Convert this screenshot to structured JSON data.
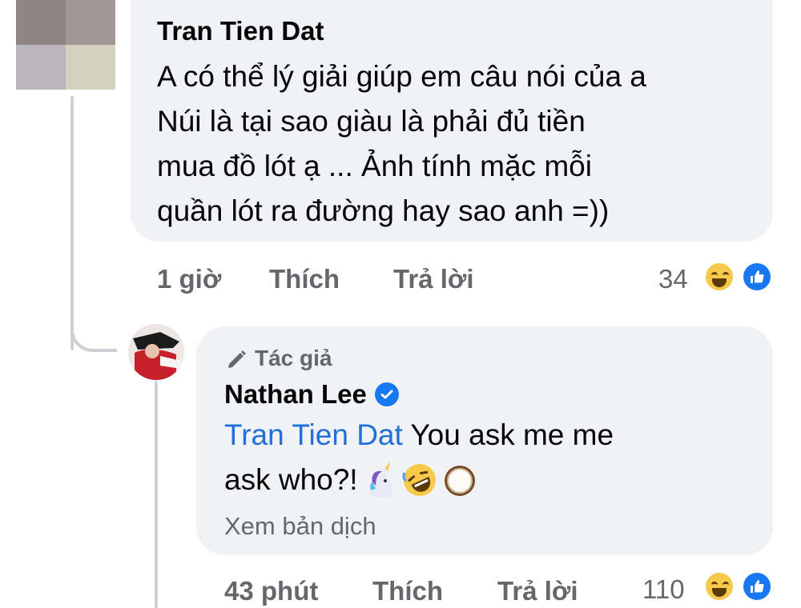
{
  "colors": {
    "bubble_bg": "#f0f2f5",
    "meta_text": "#65676b",
    "mention": "#216fdb",
    "reaction_like": "#1877f2",
    "reaction_haha": "#f7c94b"
  },
  "comment1": {
    "author": "Tran Tien Dat",
    "lines": [
      "A có thể lý giải giúp em câu nói của a",
      "Núi là tại sao giàu là phải đủ tiền",
      "mua đồ lót ạ ... Ảnh tính mặc mỗi",
      "quần lót ra đường hay sao anh =))"
    ],
    "time": "1 giờ",
    "like_label": "Thích",
    "reply_label": "Trả lời",
    "reaction_count": "34",
    "reactions": [
      "haha-icon",
      "like-icon"
    ]
  },
  "reply": {
    "author_tag": "Tác giả",
    "author": "Nathan Lee",
    "verified": true,
    "mention": "Tran Tien Dat",
    "text_line1": " You ask me me",
    "text_line2": "ask who?!",
    "emojis": [
      "unicorn-emoji",
      "rofl-emoji",
      "coconut-emoji"
    ],
    "translate_label": "Xem bản dịch",
    "time": "43 phút",
    "like_label": "Thích",
    "reply_label": "Trả lời",
    "reaction_count": "110",
    "reactions": [
      "haha-icon",
      "like-icon"
    ]
  }
}
